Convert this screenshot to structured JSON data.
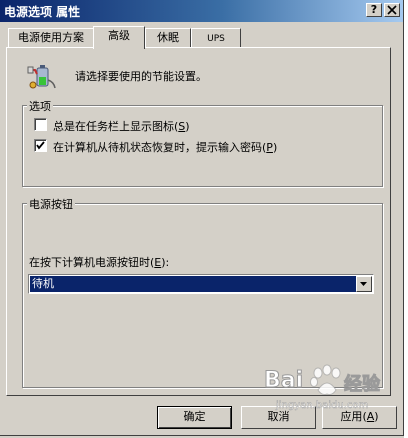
{
  "window": {
    "title": "电源选项 属性",
    "help_button": "?",
    "close_button": "✕"
  },
  "tabs": [
    {
      "label": "电源使用方案",
      "active": false
    },
    {
      "label": "高级",
      "active": true
    },
    {
      "label": "休眠",
      "active": false
    },
    {
      "label": "UPS",
      "active": false
    }
  ],
  "advanced": {
    "intro": "请选择要使用的节能设置。",
    "intro_icon": "power-plug-battery-icon",
    "options_group": {
      "legend": "选项",
      "items": [
        {
          "label": "总是在任务栏上显示图标",
          "hotkey": "S",
          "checked": false
        },
        {
          "label": "在计算机从待机状态恢复时，提示输入密码",
          "hotkey": "P",
          "checked": true
        }
      ]
    },
    "power_button_group": {
      "legend": "电源按钮",
      "select_label": "在按下计算机电源按钮时",
      "select_hotkey": "E",
      "select_value": "待机"
    }
  },
  "buttons": {
    "ok": "确定",
    "cancel": "取消",
    "apply": "应用",
    "apply_hotkey": "A"
  },
  "watermark": {
    "brand": "Bai",
    "brand_suffix": "经验",
    "url": "jingyan.baidu.com"
  },
  "colors": {
    "selection": "#0a246a",
    "face": "#d4d0c8"
  }
}
